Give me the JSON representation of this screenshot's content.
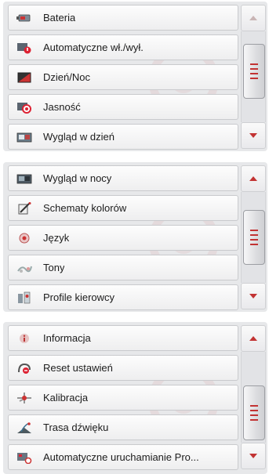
{
  "panels": [
    {
      "items": [
        {
          "label": "Bateria",
          "icon": "battery-icon"
        },
        {
          "label": "Automatyczne wł./wył.",
          "icon": "power-timer-icon"
        },
        {
          "label": "Dzień/Noc",
          "icon": "day-night-icon"
        },
        {
          "label": "Jasność",
          "icon": "brightness-icon"
        },
        {
          "label": "Wygląd w dzień",
          "icon": "day-view-icon"
        }
      ],
      "scroll_position": 0.35
    },
    {
      "items": [
        {
          "label": "Wygląd w nocy",
          "icon": "night-view-icon"
        },
        {
          "label": "Schematy kolorów",
          "icon": "color-scheme-icon"
        },
        {
          "label": "Język",
          "icon": "language-icon"
        },
        {
          "label": "Tony",
          "icon": "tones-icon"
        },
        {
          "label": "Profile kierowcy",
          "icon": "driver-profile-icon"
        }
      ],
      "scroll_position": 0.5
    },
    {
      "items": [
        {
          "label": "Informacja",
          "icon": "info-icon"
        },
        {
          "label": "Reset ustawień",
          "icon": "reset-icon"
        },
        {
          "label": "Kalibracja",
          "icon": "calibration-icon"
        },
        {
          "label": "Trasa dźwięku",
          "icon": "sound-route-icon"
        },
        {
          "label": "Automatyczne uruchamianie Pro...",
          "icon": "autostart-icon"
        }
      ],
      "scroll_position": 0.95
    }
  ],
  "colors": {
    "accent": "#c23333",
    "panel_bg": "#e7e8ea",
    "text": "#1c1c1c"
  }
}
